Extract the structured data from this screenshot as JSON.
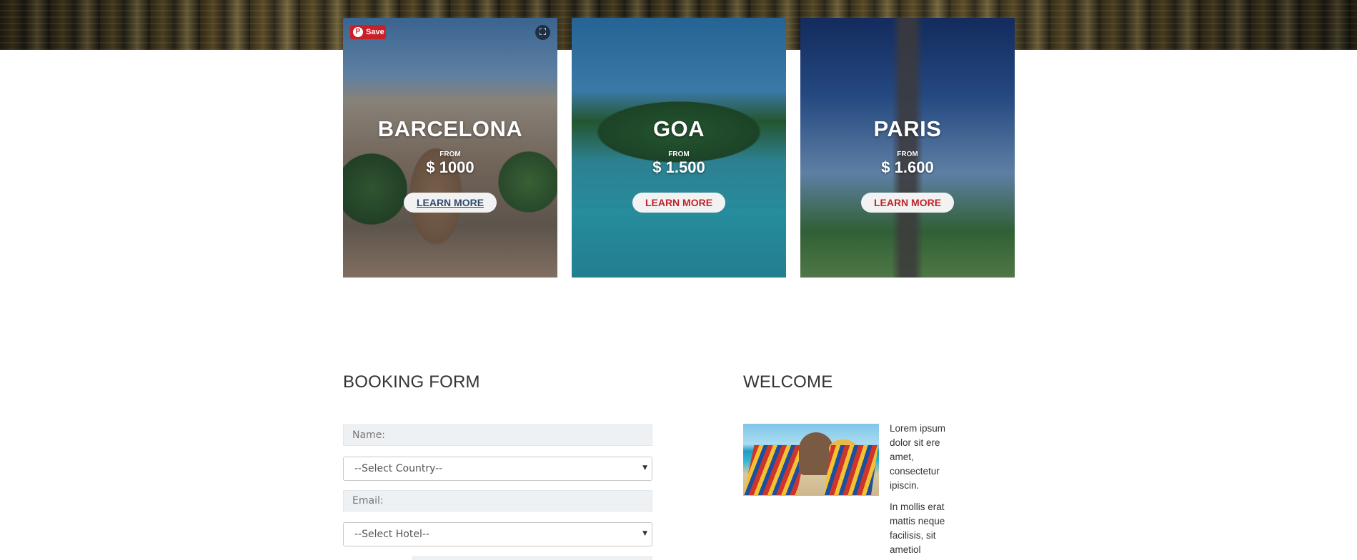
{
  "hero": {
    "destinations": [
      {
        "city": "BARCELONA",
        "from_label": "FROM",
        "price": "$ 1000",
        "button": "LEARN MORE"
      },
      {
        "city": "GOA",
        "from_label": "FROM",
        "price": "$ 1.500",
        "button": "LEARN MORE"
      },
      {
        "city": "PARIS",
        "from_label": "FROM",
        "price": "$ 1.600",
        "button": "LEARN MORE"
      }
    ],
    "pinterest_save": "Save",
    "pinterest_logo": "P",
    "expand_icon": "expand-icon"
  },
  "booking": {
    "title": "BOOKING FORM",
    "name_placeholder": "Name:",
    "country_selected": "--Select Country--",
    "email_placeholder": "Email:",
    "hotel_selected": "--Select Hotel--"
  },
  "welcome": {
    "title": "WELCOME",
    "paragraph1": "Lorem ipsum dolor sit ere amet, consectetur ipiscin.",
    "paragraph2": "In mollis erat mattis neque facilisis, sit ametiol"
  },
  "colors": {
    "accent_red": "#c0242b",
    "pinterest_red": "#cb2027",
    "input_bg": "#eef1f4"
  }
}
